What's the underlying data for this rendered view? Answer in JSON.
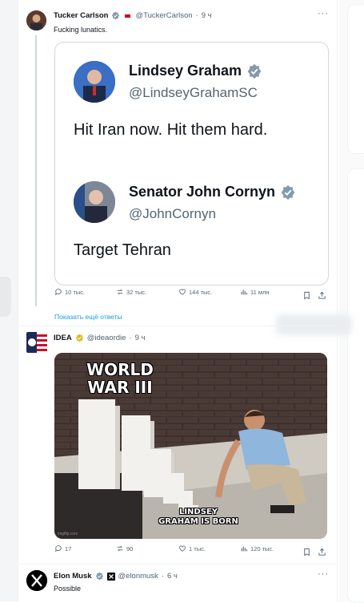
{
  "tweet1": {
    "author_name": "Tucker Carlson",
    "author_handle": "@TuckerCarlson",
    "time": "9 ч",
    "text": "Fucking lunatics.",
    "quote": {
      "first": {
        "name": "Lindsey Graham",
        "handle": "@LindseyGrahamSC",
        "text": "Hit Iran now. Hit them hard."
      },
      "second": {
        "name": "Senator John Cornyn",
        "handle": "@JohnCornyn",
        "text": "Target Tehran"
      }
    },
    "actions": {
      "replies": "10 тыс.",
      "reposts": "32 тыс.",
      "likes": "144 тыс.",
      "views": "11 млн"
    }
  },
  "show_more_replies": "Показать ещё ответы",
  "tweet2": {
    "author_name": "IDEA",
    "author_handle": "@ideaordie",
    "time": "9 ч",
    "meme": {
      "top_caption_1": "WORLD",
      "top_caption_2": "WAR III",
      "bottom_caption_1": "LINDSEY",
      "bottom_caption_2": "GRAHAM IS BORN",
      "watermark": "imgflip.com"
    },
    "actions": {
      "replies": "17",
      "reposts": "90",
      "likes": "1 тыс.",
      "views": "120 тыс."
    }
  },
  "tweet3": {
    "author_name": "Elon Musk",
    "author_handle": "@elonmusk",
    "time": "6 ч",
    "text": "Possible"
  },
  "colors": {
    "accent": "#1d9bf0",
    "verified": "#829aab",
    "muted": "#536471"
  }
}
